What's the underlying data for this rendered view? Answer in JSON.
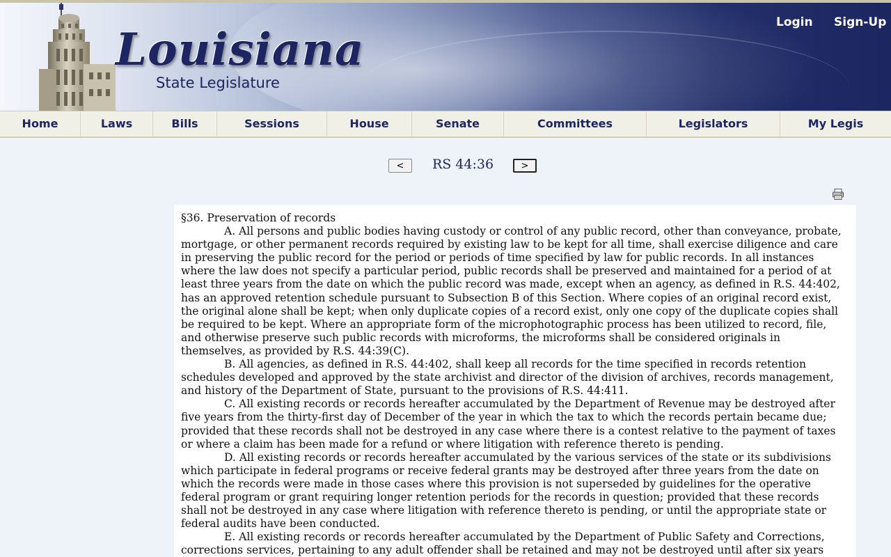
{
  "header": {
    "logo_title": "Louisiana",
    "logo_subtitle": "State Legislature",
    "login_label": "Login",
    "signup_label": "Sign-Up"
  },
  "nav": {
    "items": [
      {
        "label": "Home"
      },
      {
        "label": "Laws"
      },
      {
        "label": "Bills"
      },
      {
        "label": "Sessions"
      },
      {
        "label": "House"
      },
      {
        "label": "Senate"
      },
      {
        "label": "Committees"
      },
      {
        "label": "Legislators"
      },
      {
        "label": "My Legis"
      }
    ]
  },
  "pager": {
    "prev_label": "<",
    "title": "RS 44:36",
    "next_label": ">"
  },
  "icons": {
    "print": "print-icon"
  },
  "law": {
    "heading": "§36. Preservation of records",
    "paragraphs": [
      "A. All persons and public bodies having custody or control of any public record, other than conveyance, probate, mortgage, or other permanent records required by existing law to be kept for all time, shall exercise diligence and care in preserving the public record for the period or periods of time specified by law for public records. In all instances where the law does not specify a particular period, public records shall be preserved and maintained for a period of at least three years from the date on which the public record was made, except when an agency, as defined in R.S. 44:402, has an approved retention schedule pursuant to Subsection B of this Section. Where copies of an original record exist, the original alone shall be kept; when only duplicate copies of a record exist, only one copy of the duplicate copies shall be required to be kept. Where an appropriate form of the microphotographic process has been utilized to record, file, and otherwise preserve such public records with microforms, the microforms shall be considered originals in themselves, as provided by R.S. 44:39(C).",
      "B. All agencies, as defined in R.S. 44:402, shall keep all records for the time specified in records retention schedules developed and approved by the state archivist and director of the division of archives, records management, and history of the Department of State, pursuant to the provisions of R.S. 44:411.",
      "C. All existing records or records hereafter accumulated by the Department of Revenue may be destroyed after five years from the thirty-first day of December of the year in which the tax to which the records pertain became due; provided that these records shall not be destroyed in any case where there is a contest relative to the payment of taxes or where a claim has been made for a refund or where litigation with reference thereto is pending.",
      "D. All existing records or records hereafter accumulated by the various services of the state or its subdivisions which participate in federal programs or receive federal grants may be destroyed after three years from the date on which the records were made in those cases where this provision is not superseded by guidelines for the operative federal program or grant requiring longer retention periods for the records in question; provided that these records shall not be destroyed in any case where litigation with reference thereto is pending, or until the appropriate state or federal audits have been conducted.",
      "E. All existing records or records hereafter accumulated by the Department of Public Safety and Corrections, corrections services, pertaining to any adult offender shall be retained and may not be destroyed until after six years"
    ]
  }
}
